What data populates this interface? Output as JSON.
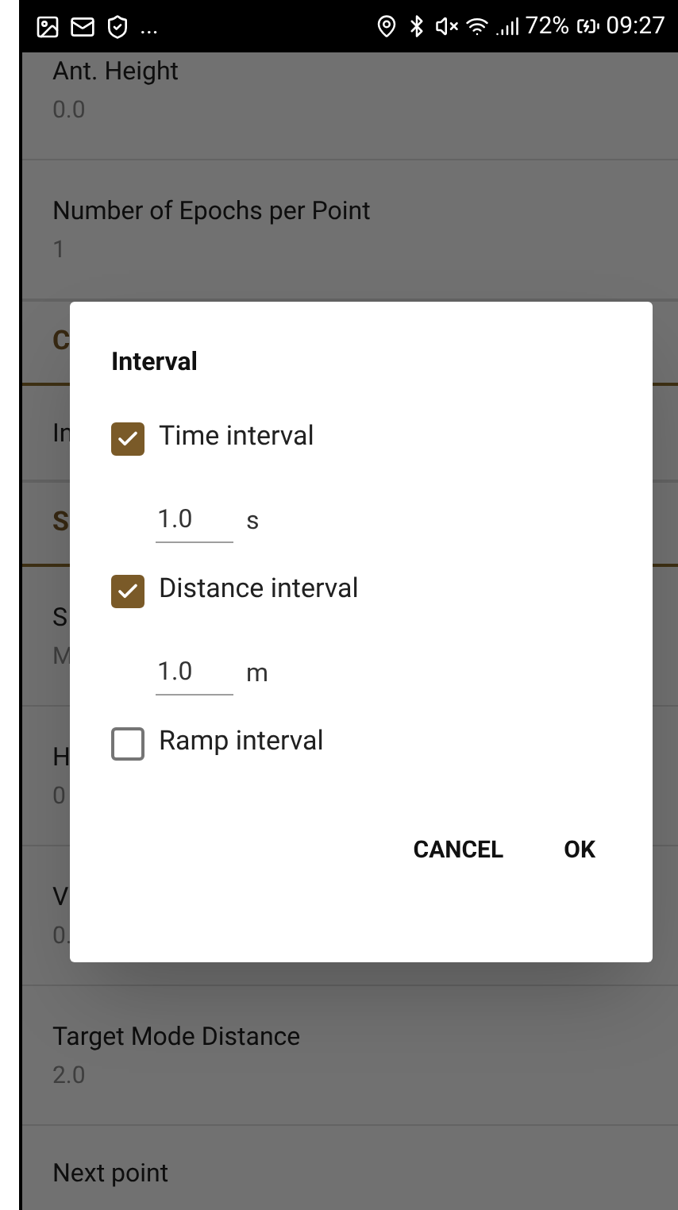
{
  "status_bar": {
    "notification_overflow": "...",
    "battery": "72%",
    "time": "09:27"
  },
  "settings": [
    {
      "kind": "item",
      "title": "Ant. Height",
      "value": "0.0"
    },
    {
      "kind": "item",
      "title": "Number of Epochs per Point",
      "value": "1"
    },
    {
      "kind": "header",
      "title": "C"
    },
    {
      "kind": "item",
      "title": "In"
    },
    {
      "kind": "header",
      "title": "S"
    },
    {
      "kind": "item",
      "title": "S",
      "value": "M"
    },
    {
      "kind": "item",
      "title": "H",
      "value": "0"
    },
    {
      "kind": "item",
      "title": "V",
      "value": "0."
    },
    {
      "kind": "item",
      "title": "Target Mode Distance",
      "value": "2.0"
    },
    {
      "kind": "item",
      "title": "Next point"
    }
  ],
  "dialog": {
    "title": "Interval",
    "options": [
      {
        "label": "Time interval",
        "checked": true,
        "value": "1.0",
        "unit": "s"
      },
      {
        "label": "Distance interval",
        "checked": true,
        "value": "1.0",
        "unit": "m"
      },
      {
        "label": "Ramp interval",
        "checked": false
      }
    ],
    "buttons": [
      "CANCEL",
      "OK"
    ]
  }
}
